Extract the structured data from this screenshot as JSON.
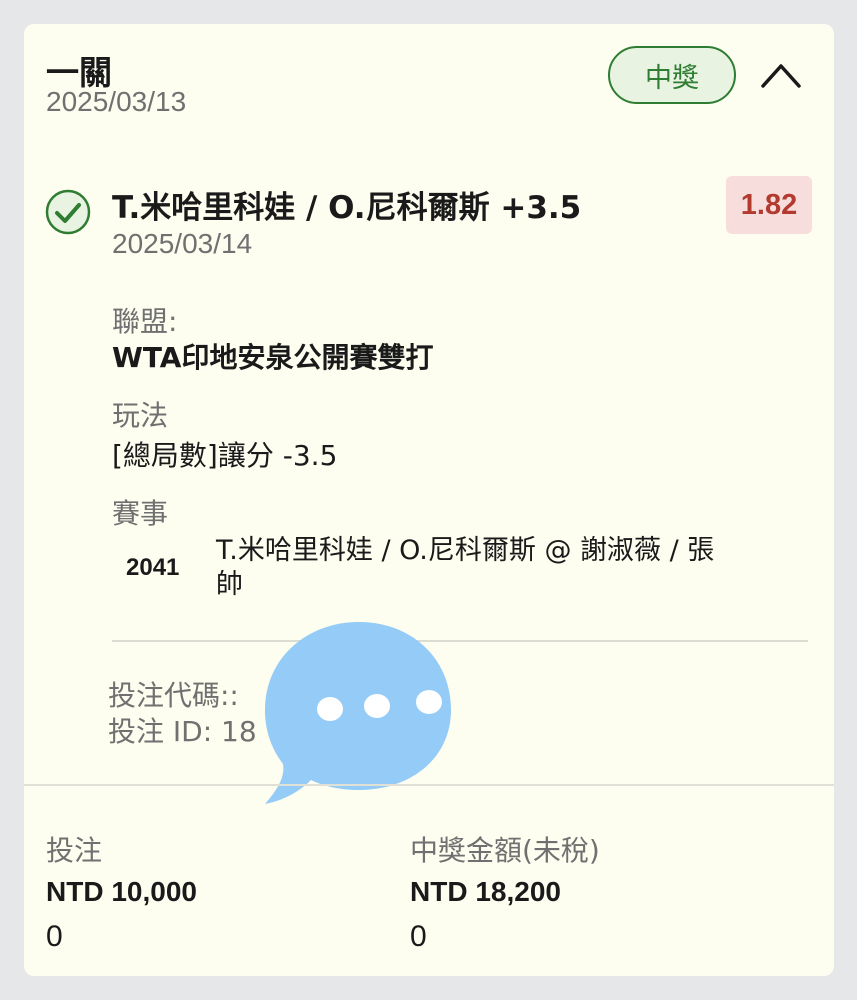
{
  "bet": {
    "type_title": "一關",
    "placed_date": "2025/03/13",
    "status": "中獎",
    "collapse_icon": "chevron-up-icon",
    "accent_color": "#2e7d32",
    "odds_color": "#b23a2f"
  },
  "selection": {
    "status_icon": "check-circle-icon",
    "title": "T.米哈里科娃 / O.尼科爾斯 +3.5",
    "odds": "1.82",
    "date": "2025/03/14"
  },
  "league": {
    "label": "聯盟:",
    "value": "WTA印地安泉公開賽雙打"
  },
  "market": {
    "label": "玩法",
    "value": "[總局數]讓分 -3.5"
  },
  "event": {
    "label": "賽事",
    "id": "2041",
    "name": "T.米哈里科娃 / O.尼科爾斯 @ 謝淑薇 / 張帥"
  },
  "bet_info": {
    "code_label": "投注代碼::",
    "id_label": "投注 ID: 18"
  },
  "footer": {
    "stake_label": "投注",
    "stake_value": "NTD 10,000",
    "stake_extra": "0",
    "payout_label": "中獎金額(未稅)",
    "payout_value": "NTD 18,200",
    "payout_extra": "0"
  },
  "overlay": {
    "icon": "speech-bubble-icon",
    "color": "#94cbf7"
  }
}
